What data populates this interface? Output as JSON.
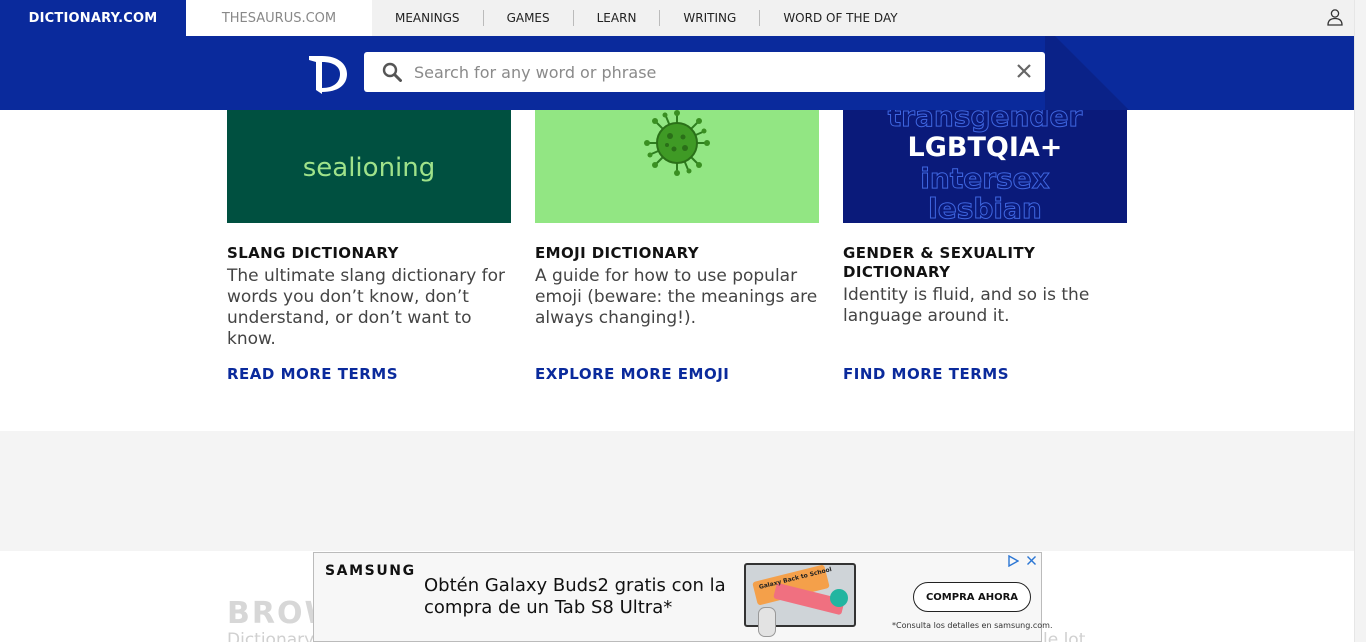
{
  "nav": {
    "dictionary_tab": "DICTIONARY.COM",
    "thesaurus_tab": "THESAURUS.COM",
    "links": [
      "MEANINGS",
      "GAMES",
      "LEARN",
      "WRITING",
      "WORD OF THE DAY"
    ],
    "user_icon": "user-icon"
  },
  "search": {
    "placeholder": "Search for any word or phrase",
    "value": ""
  },
  "cards": [
    {
      "image_text": "sealioning",
      "title": "SLANG DICTIONARY",
      "description": "The ultimate slang dictionary for words you don’t know, don’t understand, or don’t want to know.",
      "link": "READ MORE TERMS"
    },
    {
      "image_icon": "virus-icon",
      "title": "EMOJI DICTIONARY",
      "description": "A guide for how to use popular emoji (beware: the meanings are always changing!).",
      "link": "EXPLORE MORE EMOJI"
    },
    {
      "image_words": [
        "transgender",
        "LGBTQIA+",
        "intersex",
        "lesbian"
      ],
      "title": "GENDER & SEXUALITY DICTIONARY",
      "description": "Identity is fluid, and so is the language around it.",
      "link": "FIND MORE TERMS"
    }
  ],
  "browse": {
    "heading": "BROW",
    "sub_start": "Dictionary",
    "sub_end": "le lot"
  },
  "ad": {
    "brand": "SAMSUNG",
    "headline": "Obtén Galaxy Buds2 gratis con la compra de un Tab S8 Ultra*",
    "product_text": "Galaxy Back to School",
    "cta": "COMPRA AHORA",
    "note": "*Consulta los detalles en samsung.com."
  },
  "colors": {
    "brand_blue": "#0a2a9c",
    "slang_bg": "#005040",
    "emoji_bg": "#92e683",
    "gender_bg": "#0a1a7a"
  }
}
